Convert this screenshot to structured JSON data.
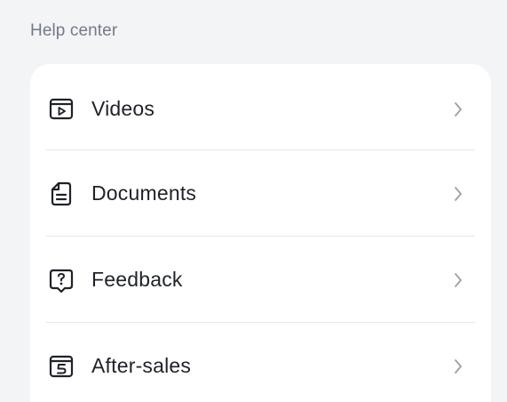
{
  "help_center": {
    "title": "Help center",
    "items": [
      {
        "label": "Videos",
        "icon": "video-play-icon"
      },
      {
        "label": "Documents",
        "icon": "document-icon"
      },
      {
        "label": "Feedback",
        "icon": "feedback-icon"
      },
      {
        "label": "After-sales",
        "icon": "after-sales-icon"
      }
    ]
  },
  "colors": {
    "background": "#f3f4f6",
    "card": "#ffffff",
    "text": "#1f2229",
    "section_title": "#737a87",
    "chevron": "#9aa0aa",
    "divider": "#e6e7ea"
  }
}
